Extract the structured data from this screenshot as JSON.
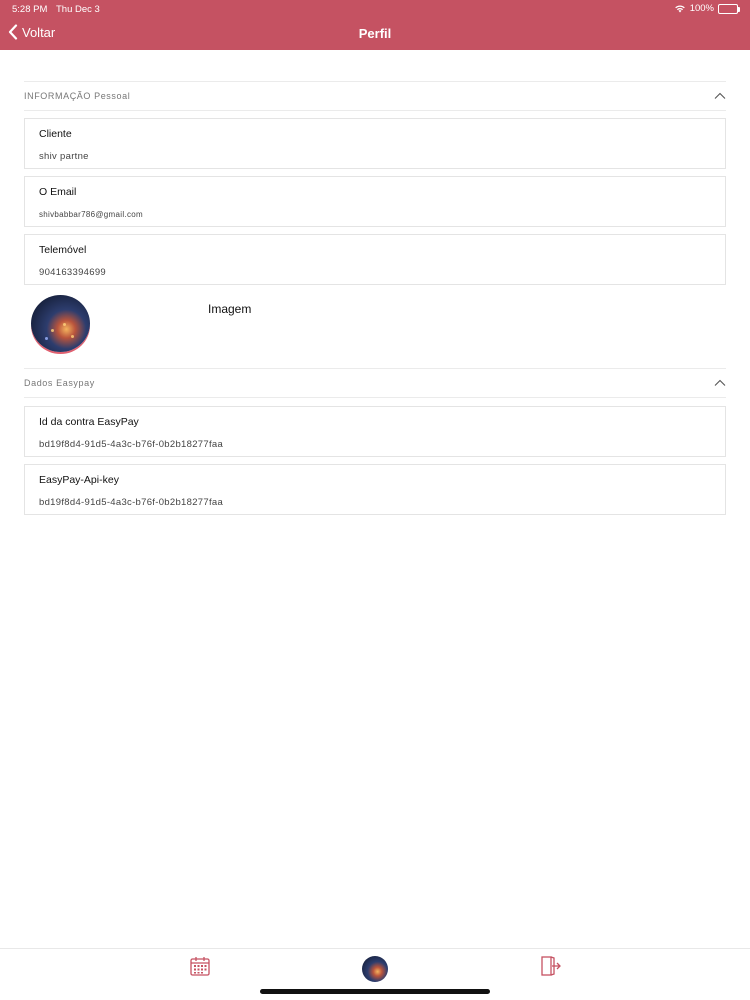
{
  "status_bar": {
    "time": "5:28 PM",
    "date": "Thu Dec 3",
    "battery": "100%"
  },
  "nav": {
    "back_label": "Voltar",
    "title": "Perfil"
  },
  "sections": {
    "personal": {
      "title": "INFORMAÇÃO Pessoal",
      "fields": [
        {
          "label": "Cliente",
          "value": "shiv partne"
        },
        {
          "label": "O Email",
          "value": "shivbabbar786@gmail.com"
        },
        {
          "label": "Telemóvel",
          "value": "904163394699"
        }
      ],
      "image_label": "Imagem"
    },
    "easypay": {
      "title": "Dados Easypay",
      "fields": [
        {
          "label": "Id da contra EasyPay",
          "value": "bd19f8d4-91d5-4a3c-b76f-0b2b18277faa"
        },
        {
          "label": "EasyPay-Api-key",
          "value": "bd19f8d4-91d5-4a3c-b76f-0b2b18277faa"
        }
      ]
    }
  },
  "tabbar": {
    "items": [
      {
        "icon": "calendar-icon"
      },
      {
        "icon": "avatar"
      },
      {
        "icon": "logout-icon"
      }
    ]
  },
  "colors": {
    "accent": "#c55262",
    "divider": "#ebebeb"
  }
}
